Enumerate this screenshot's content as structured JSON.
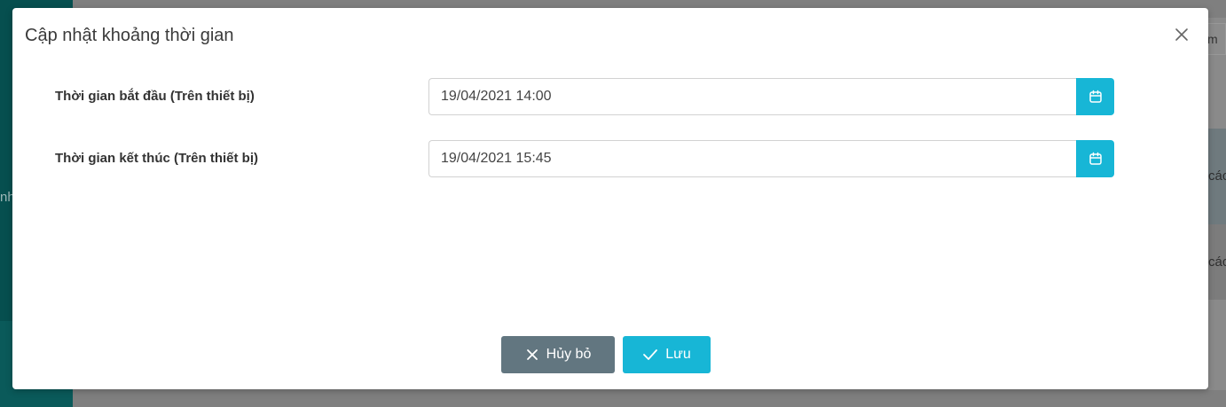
{
  "background": {
    "left_fragment": "nh",
    "right_input_fragment": "m",
    "right_text_1": "các",
    "right_text_2": "các"
  },
  "dialog": {
    "title": "Cập nhật khoảng thời gian",
    "close_icon": "close-icon",
    "fields": [
      {
        "label": "Thời gian bắt đầu (Trên thiết bị)",
        "value": "19/04/2021 14:00",
        "icon": "calendar-icon"
      },
      {
        "label": "Thời gian kết thúc (Trên thiết bị)",
        "value": "19/04/2021 15:45",
        "icon": "calendar-icon"
      }
    ],
    "buttons": {
      "cancel_label": "Hủy bỏ",
      "cancel_icon": "x-icon",
      "save_label": "Lưu",
      "save_icon": "check-icon"
    }
  },
  "colors": {
    "accent": "#17b6d6",
    "cancel": "#627680",
    "sidebar": "#064f4f"
  }
}
